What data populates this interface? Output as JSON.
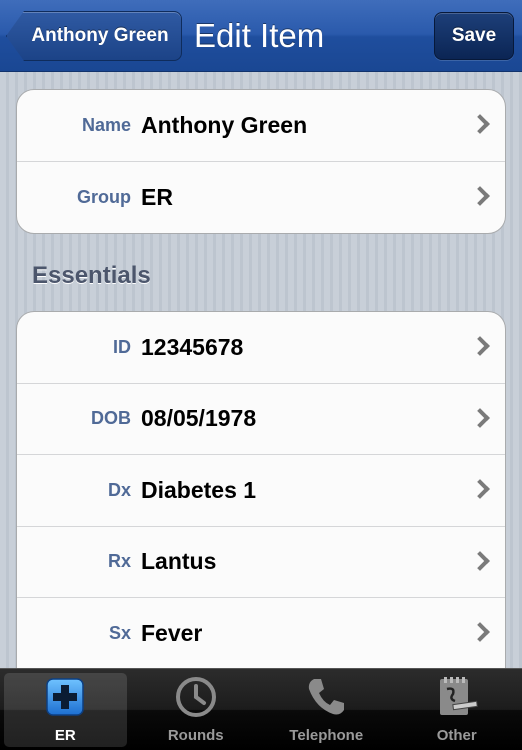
{
  "navbar": {
    "back_label": "Anthony Green",
    "title": "Edit Item",
    "save_label": "Save"
  },
  "top_group": [
    {
      "key": "Name",
      "value": "Anthony Green"
    },
    {
      "key": "Group",
      "value": "ER"
    }
  ],
  "essentials": {
    "header": "Essentials",
    "rows": [
      {
        "key": "ID",
        "value": "12345678"
      },
      {
        "key": "DOB",
        "value": "08/05/1978"
      },
      {
        "key": "Dx",
        "value": "Diabetes 1"
      },
      {
        "key": "Rx",
        "value": "Lantus"
      },
      {
        "key": "Sx",
        "value": "Fever"
      }
    ]
  },
  "tabbar": {
    "tabs": [
      {
        "label": "ER",
        "icon": "medical-cross-icon",
        "selected": true
      },
      {
        "label": "Rounds",
        "icon": "clock-icon",
        "selected": false
      },
      {
        "label": "Telephone",
        "icon": "telephone-icon",
        "selected": false
      },
      {
        "label": "Other",
        "icon": "notepad-pen-icon",
        "selected": false
      }
    ]
  },
  "colors": {
    "navbar": "#2a5aac",
    "key_label": "#506a97",
    "tab_selected_icon": "#3a8fdd"
  }
}
